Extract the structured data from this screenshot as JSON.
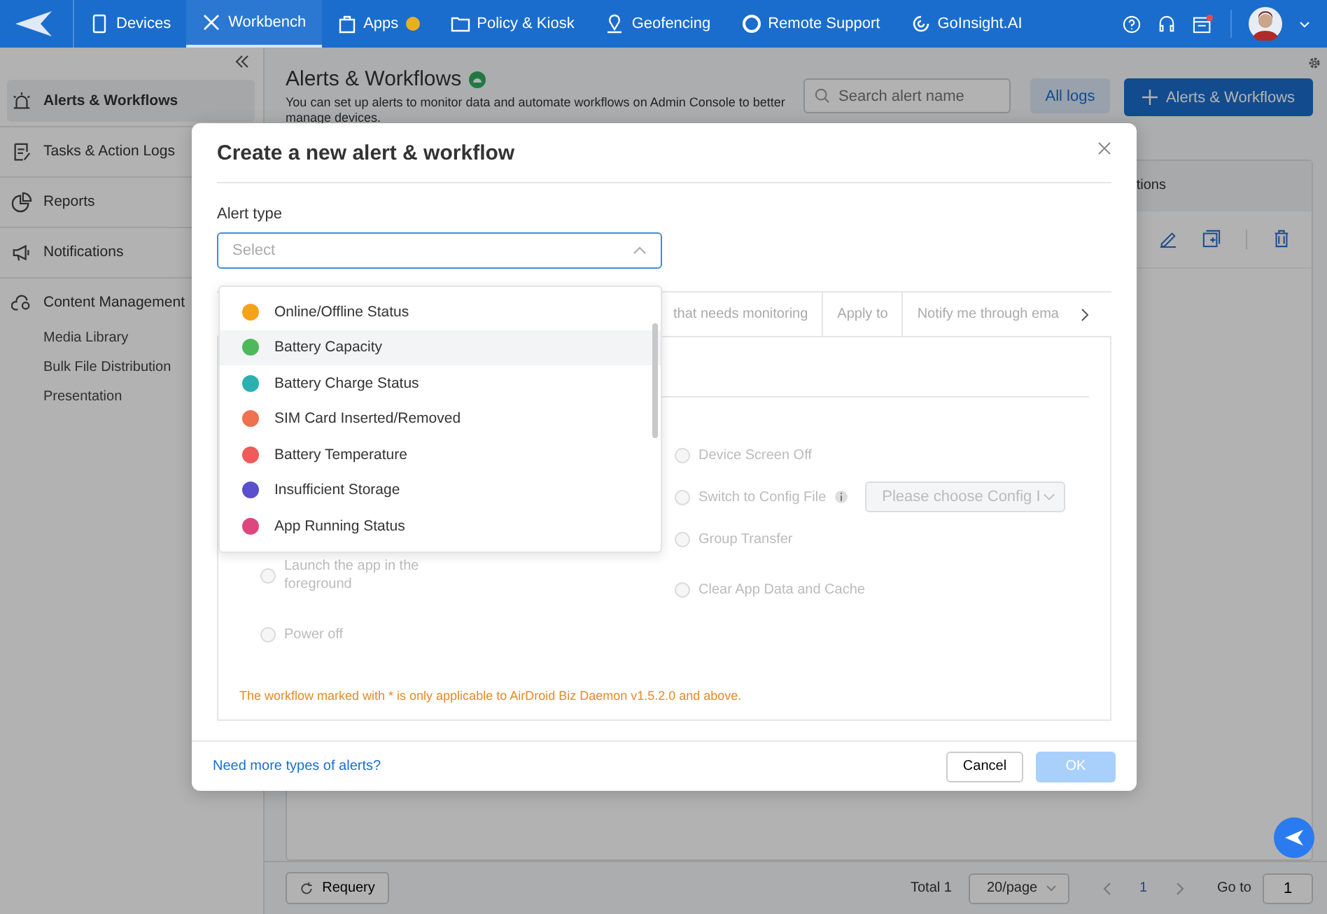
{
  "nav": {
    "items": [
      {
        "label": "Devices",
        "selected": false,
        "badge": false
      },
      {
        "label": "Workbench",
        "selected": true,
        "badge": false
      },
      {
        "label": "Apps",
        "selected": false,
        "badge": true
      },
      {
        "label": "Policy & Kiosk",
        "selected": false,
        "badge": false
      },
      {
        "label": "Geofencing",
        "selected": false,
        "badge": false
      },
      {
        "label": "Remote Support",
        "selected": false,
        "badge": false
      },
      {
        "label": "GoInsight.AI",
        "selected": false,
        "badge": false
      }
    ]
  },
  "sidebar": {
    "items": [
      {
        "label": "Alerts & Workflows",
        "selected": true
      },
      {
        "label": "Tasks & Action Logs",
        "selected": false
      },
      {
        "label": "Reports",
        "selected": false
      },
      {
        "label": "Notifications",
        "selected": false
      },
      {
        "label": "Content Management",
        "selected": false,
        "children": [
          {
            "label": "Media Library"
          },
          {
            "label": "Bulk File Distribution"
          },
          {
            "label": "Presentation"
          }
        ]
      }
    ]
  },
  "page": {
    "title": "Alerts & Workflows",
    "description": "You can set up alerts to monitor data and automate workflows on Admin Console to better manage devices.",
    "search": {
      "placeholder": "Search alert name"
    },
    "logs_button": "All logs",
    "create_button": "Alerts & Workflows",
    "table": {
      "column_header": "tions"
    }
  },
  "bottom_bar": {
    "requery": "Requery",
    "total": "Total 1",
    "page_size": "20/page",
    "current_page": "1",
    "goto_label": "Go to",
    "goto_value": "1"
  },
  "dialog": {
    "title": "Create a new alert & workflow",
    "alert_type_label": "Alert type",
    "select": {
      "placeholder": "Select",
      "open": true
    },
    "options": [
      {
        "label": "Online/Offline Status",
        "color": "#f5a21b",
        "highlighted": false
      },
      {
        "label": "Battery Capacity",
        "color": "#4cb95a",
        "highlighted": true
      },
      {
        "label": "Battery Charge Status",
        "color": "#2bb0b0",
        "highlighted": false
      },
      {
        "label": "SIM Card Inserted/Removed",
        "color": "#ee7150",
        "highlighted": false
      },
      {
        "label": "Battery Temperature",
        "color": "#f05a5a",
        "highlighted": false
      },
      {
        "label": "Insufficient Storage",
        "color": "#5a4fcc",
        "highlighted": false
      },
      {
        "label": "App Running Status",
        "color": "#de4680",
        "highlighted": false
      }
    ],
    "tabs": [
      {
        "label": "that needs monitoring",
        "selected": false
      },
      {
        "label": "Apply to",
        "selected": false
      },
      {
        "label": "Notify me through ema",
        "selected": false
      }
    ],
    "actions_left": [
      {
        "label": "Launch the app in the foreground",
        "checked": false
      },
      {
        "label": "Power off",
        "checked": false
      }
    ],
    "actions_right": [
      {
        "label": "Device Screen Off",
        "kind": "radio",
        "checked": false
      },
      {
        "label": "Switch to Config File",
        "kind": "config",
        "checked": false,
        "placeholder": "Please choose Config I"
      },
      {
        "label": "Group Transfer",
        "kind": "radio",
        "checked": false
      },
      {
        "label": "Clear App Data and Cache",
        "kind": "radio",
        "checked": false
      }
    ],
    "note": "The workflow marked with * is only applicable to AirDroid Biz Daemon v1.5.2.0 and above.",
    "help_link": "Need more types of alerts?",
    "cancel": "Cancel",
    "ok": {
      "label": "OK",
      "disabled": true
    }
  }
}
